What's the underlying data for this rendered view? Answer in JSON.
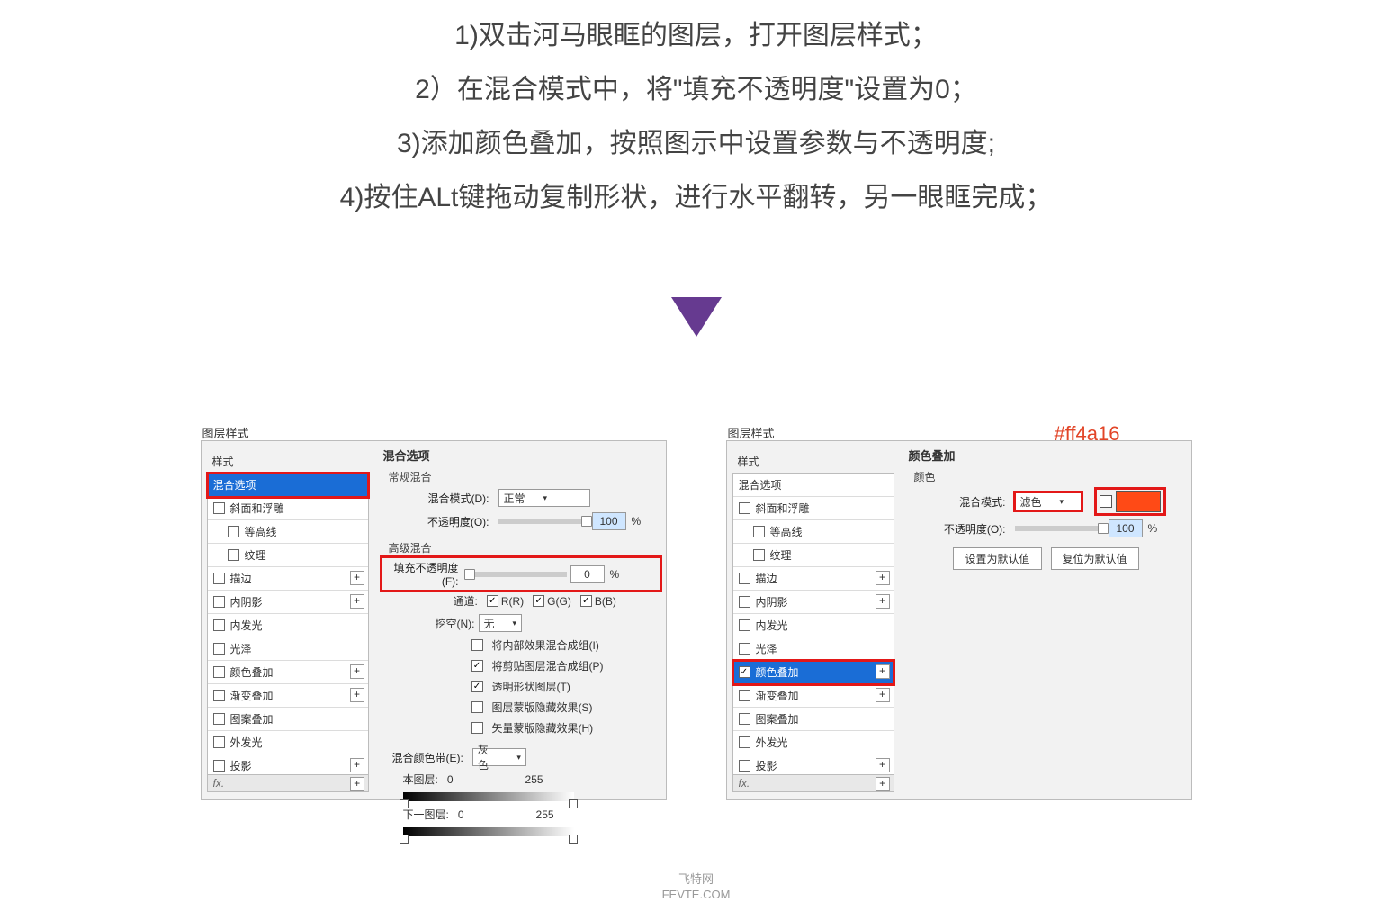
{
  "instructions": {
    "line1": "1)双击河马眼眶的图层，打开图层样式；",
    "line2": "2）在混合模式中，将\"填充不透明度\"设置为0；",
    "line3": "3)添加颜色叠加，按照图示中设置参数与不透明度;",
    "line4": "4)按住ALt键拖动复制形状，进行水平翻转，另一眼眶完成；"
  },
  "hex_label": "#ff4a16",
  "hex_color": "#ff4a16",
  "panel_title": "图层样式",
  "styles_header": "样式",
  "styles": {
    "blendOptions": "混合选项",
    "bevel": "斜面和浮雕",
    "contour": "等高线",
    "texture": "纹理",
    "stroke": "描边",
    "innerShadow": "内阴影",
    "innerGlow": "内发光",
    "satin": "光泽",
    "colorOverlay": "颜色叠加",
    "gradientOverlay": "渐变叠加",
    "patternOverlay": "图案叠加",
    "outerGlow": "外发光",
    "dropShadow": "投影"
  },
  "fx_label": "fx.",
  "leftPanel": {
    "section": "混合选项",
    "general": "常规混合",
    "blendMode": {
      "label": "混合模式(D):",
      "value": "正常"
    },
    "opacity": {
      "label": "不透明度(O):",
      "value": "100"
    },
    "advanced": "高级混合",
    "fillOpacity": {
      "label": "填充不透明度(F):",
      "value": "0"
    },
    "channels": {
      "label": "通道:",
      "r": "R(R)",
      "g": "G(G)",
      "b": "B(B)"
    },
    "knockout": {
      "label": "挖空(N):",
      "value": "无"
    },
    "opts": {
      "a": "将内部效果混合成组(I)",
      "b": "将剪贴图层混合成组(P)",
      "c": "透明形状图层(T)",
      "d": "图层蒙版隐藏效果(S)",
      "e": "矢量蒙版隐藏效果(H)"
    },
    "blendIf": {
      "label": "混合颜色带(E):",
      "value": "灰色"
    },
    "thisLayer": {
      "label": "本图层:",
      "v0": "0",
      "v1": "255"
    },
    "underlying": {
      "label": "下一图层:",
      "v0": "0",
      "v1": "255"
    }
  },
  "rightPanel": {
    "section": "颜色叠加",
    "colorHdr": "颜色",
    "blendMode": {
      "label": "混合模式:",
      "value": "滤色"
    },
    "opacity": {
      "label": "不透明度(O):",
      "value": "100"
    },
    "swatch": "#ff4a16",
    "btn_default": "设置为默认值",
    "btn_reset": "复位为默认值"
  },
  "watermark": {
    "l1": "飞特网",
    "l2": "FEVTE.COM"
  },
  "pct": "%"
}
